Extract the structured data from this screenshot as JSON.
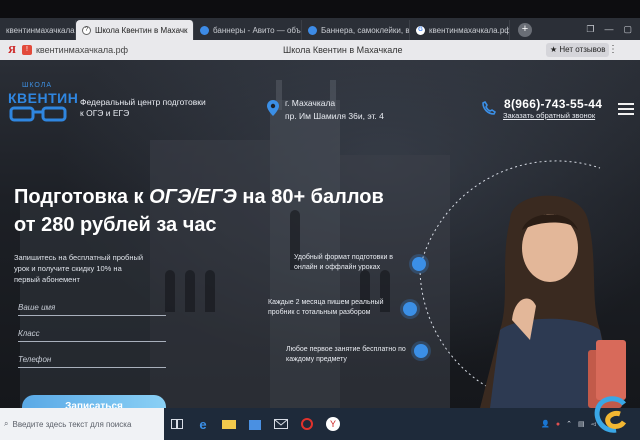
{
  "browser": {
    "tabs": [
      {
        "label": "квентинмахачкала.рф —",
        "favicon": "site-icon",
        "active": false
      },
      {
        "label": "Школа Квентин в Махачк",
        "favicon": "page-icon",
        "active": true
      },
      {
        "label": "баннеры - Авито — объ",
        "favicon": "avito-icon",
        "active": false
      },
      {
        "label": "Баннера, самоклейки, ві",
        "favicon": "avito-icon",
        "active": false
      },
      {
        "label": "квентинмахачкала.рф",
        "favicon": "google-icon",
        "active": false
      }
    ],
    "new_tab": "+",
    "address": "квентинмахачкала.рф",
    "page_title": "Школа Квентин в Махачкале",
    "reviews_label": "Нет отзывов",
    "logo_letter": "Я"
  },
  "site": {
    "logo_top": "ШКОЛА",
    "logo_main": "КВЕНТИН",
    "tagline": "Федеральный центр подготовки к ОГЭ и ЕГЭ",
    "city": "г. Махачкала",
    "street": "пр. Им Шамиля 36и, эт. 4",
    "phone": "8(966)-743-55-44",
    "callback": "Заказать обратный звонок",
    "headline_part1": "Подготовка к ",
    "headline_em": "ОГЭ/ЕГЭ",
    "headline_part2": " на 80+ баллов",
    "headline_line2": "от 280 рублей за час",
    "subtext": "Запишитесь на бесплатный пробный урок и получите скидку 10% на первый абонемент",
    "form": {
      "name_placeholder": "Ваше имя",
      "class_placeholder": "Класс",
      "phone_placeholder": "Телефон",
      "submit": "Записаться"
    },
    "benefits": [
      "Удобный формат подготовки в онлайн и оффлайн уроках",
      "Каждые 2 месяца пишем реальный пробник с тотальным разбором",
      "Любое первое занятие бесплатно по каждому предмету"
    ],
    "accent_color": "#3b8fe6"
  },
  "taskbar": {
    "search_placeholder": "Введите здесь текст для поиска"
  }
}
